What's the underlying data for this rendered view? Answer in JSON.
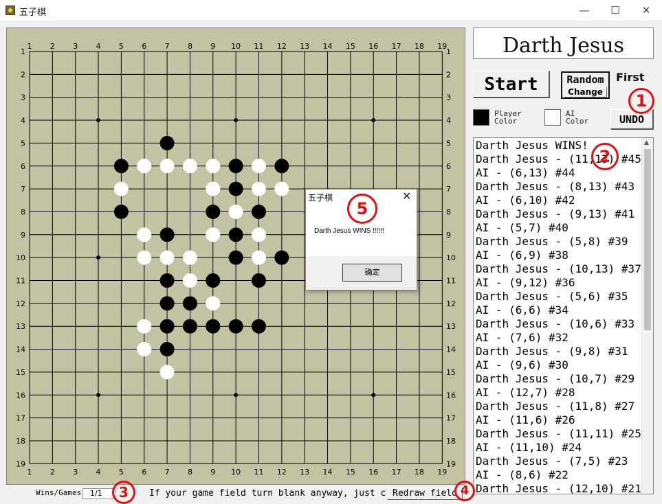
{
  "window": {
    "title": "五子棋",
    "minimize_glyph": "—",
    "maximize_glyph": "☐",
    "close_glyph": "✕"
  },
  "board": {
    "size": 19,
    "star_points": [
      [
        4,
        4
      ],
      [
        10,
        4
      ],
      [
        16,
        4
      ],
      [
        4,
        10
      ],
      [
        10,
        10
      ],
      [
        16,
        10
      ],
      [
        4,
        16
      ],
      [
        10,
        16
      ],
      [
        16,
        16
      ]
    ],
    "black_stones": [
      [
        7,
        5
      ],
      [
        5,
        6
      ],
      [
        10,
        6
      ],
      [
        12,
        6
      ],
      [
        10,
        7
      ],
      [
        5,
        8
      ],
      [
        9,
        8
      ],
      [
        11,
        8
      ],
      [
        7,
        9
      ],
      [
        10,
        9
      ],
      [
        10,
        10
      ],
      [
        12,
        10
      ],
      [
        7,
        11
      ],
      [
        9,
        11
      ],
      [
        11,
        11
      ],
      [
        7,
        12
      ],
      [
        8,
        12
      ],
      [
        7,
        13
      ],
      [
        8,
        13
      ],
      [
        9,
        13
      ],
      [
        10,
        13
      ],
      [
        11,
        13
      ],
      [
        7,
        14
      ]
    ],
    "white_stones": [
      [
        6,
        6
      ],
      [
        7,
        6
      ],
      [
        8,
        6
      ],
      [
        9,
        6
      ],
      [
        11,
        6
      ],
      [
        5,
        7
      ],
      [
        9,
        7
      ],
      [
        11,
        7
      ],
      [
        12,
        7
      ],
      [
        10,
        8
      ],
      [
        6,
        9
      ],
      [
        9,
        9
      ],
      [
        11,
        9
      ],
      [
        6,
        10
      ],
      [
        7,
        10
      ],
      [
        8,
        10
      ],
      [
        11,
        10
      ],
      [
        8,
        11
      ],
      [
        9,
        12
      ],
      [
        6,
        13
      ],
      [
        6,
        14
      ],
      [
        7,
        15
      ]
    ],
    "colors": {
      "background": "#c3c3a3",
      "grid": "#000000",
      "black": "#000000",
      "white": "#ffffff"
    }
  },
  "player": {
    "name": "Darth Jesus"
  },
  "controls": {
    "start_label": "Start",
    "random_label": "Random",
    "change_label": "Change",
    "first_label": "First",
    "undo_label": "UNDO",
    "player_color_label_1": "Player",
    "player_color_label_2": "Color",
    "ai_color_label_1": "AI",
    "ai_color_label_2": "Color",
    "player_color": "#000000",
    "ai_color": "#ffffff"
  },
  "log": [
    "Darth Jesus WINS!",
    "Darth Jesus - (11,13) #45",
    "AI - (6,13) #44",
    "Darth Jesus - (8,13) #43",
    "AI - (6,10) #42",
    "Darth Jesus - (9,13) #41",
    "AI - (5,7) #40",
    "Darth Jesus - (5,8) #39",
    "AI - (6,9) #38",
    "Darth Jesus - (10,13) #37",
    "AI - (9,12) #36",
    "Darth Jesus - (5,6) #35",
    "AI - (6,6) #34",
    "Darth Jesus - (10,6) #33",
    "AI - (7,6) #32",
    "Darth Jesus - (9,8) #31",
    "AI - (9,6) #30",
    "Darth Jesus - (10,7) #29",
    "AI - (12,7) #28",
    "Darth Jesus - (11,8) #27",
    "AI - (11,6) #26",
    "Darth Jesus - (11,11) #25",
    "AI - (11,10) #24",
    "Darth Jesus - (7,5) #23",
    "AI - (8,6) #22",
    "Darth Jesus - (12,10) #21"
  ],
  "status_bar": {
    "wins_games_label": "Wins/Games",
    "wins_games_value": "1/1",
    "hint_text": "If your game field turn blank anyway, just click",
    "redraw_label": "Redraw field"
  },
  "dialog": {
    "title": "五子棋",
    "message": "Darth Jesus WINS !!!!!!",
    "ok_label": "确定",
    "close_glyph": "✕"
  },
  "annotations": {
    "one": "1",
    "two": "2",
    "three": "3",
    "four": "4",
    "five": "5",
    "color": "#e01010"
  }
}
